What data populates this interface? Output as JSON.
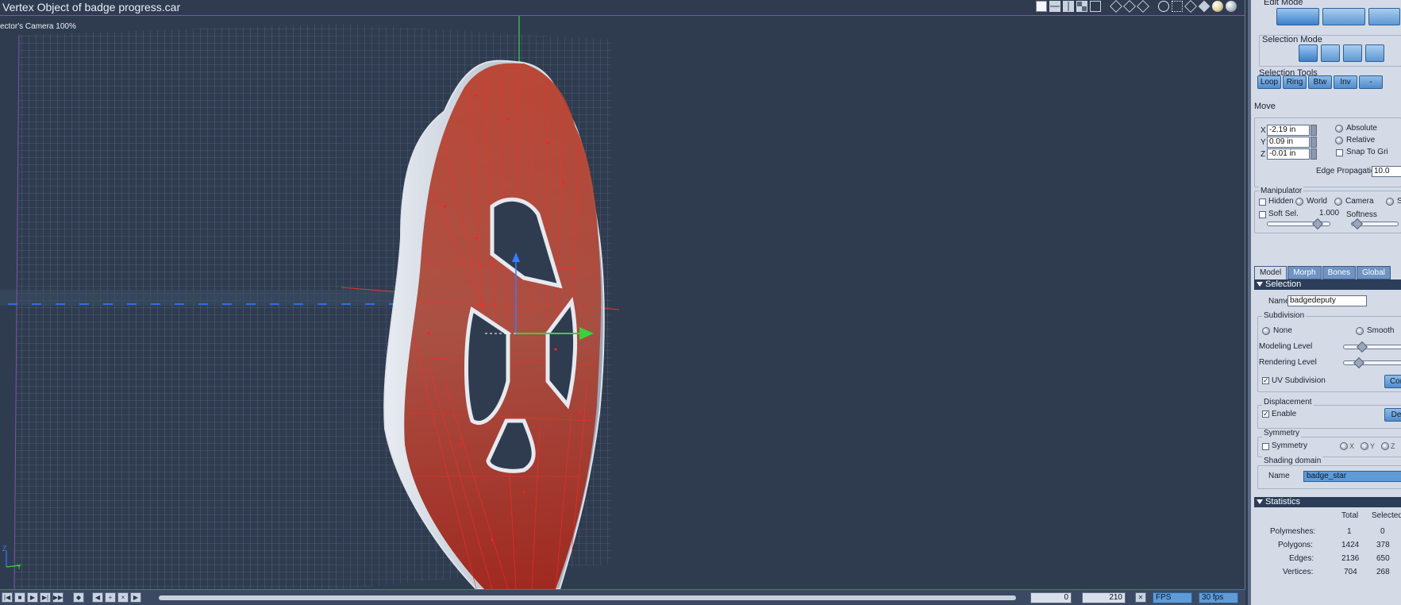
{
  "viewport": {
    "title": "Vertex Object of badge progress.car",
    "camera_label": "ector's Camera 100%",
    "axis_labels": {
      "z": "Z",
      "y": "Y"
    }
  },
  "timeline": {
    "current_frame": "0",
    "end_frame": "210",
    "mode": "FPS",
    "fps": "30 fps"
  },
  "panel": {
    "edit_mode_label": "Edit Mode",
    "selection_mode_label": "Selection Mode",
    "selection_tools_label": "Selection Tools",
    "selection_tools": [
      "Loop",
      "Ring",
      "Btw",
      "Inv",
      "-"
    ],
    "move_label": "Move",
    "move": {
      "x_label": "X",
      "x_value": "-2.19 in",
      "y_label": "Y",
      "y_value": "0.09 in",
      "z_label": "Z",
      "z_value": "-0.01 in",
      "absolute": "Absolute",
      "relative": "Relative",
      "snap": "Snap To Gri",
      "edge_prop_label": "Edge Propagation",
      "edge_prop_value": "10.0"
    },
    "manipulator": {
      "label": "Manipulator",
      "hidden": "Hidden",
      "world": "World",
      "camera": "Camera",
      "screen": "S",
      "soft_sel": "Soft Sel.",
      "soft_sel_value": "1.000",
      "softness": "Softness"
    },
    "tabs": [
      "Model",
      "Morph",
      "Bones",
      "Global"
    ],
    "selection_header": "Selection",
    "name_label": "Name",
    "name_value": "badgedeputy",
    "subdivision": {
      "label": "Subdivision",
      "none": "None",
      "smooth": "Smooth",
      "modeling_level": "Modeling Level",
      "rendering_level": "Rendering Level",
      "uv_subdivision": "UV Subdivision",
      "config_button": "Cor"
    },
    "displacement": {
      "label": "Displacement",
      "enable": "Enable",
      "button": "De"
    },
    "symmetry": {
      "label": "Symmetry",
      "checkbox": "Symmetry",
      "x": "X",
      "y": "Y",
      "z": "Z"
    },
    "shading_domain": {
      "label": "Shading domain",
      "name_label": "Name",
      "value": "badge_star"
    },
    "statistics": {
      "header": "Statistics",
      "col_total": "Total",
      "col_selected": "Selected",
      "rows": [
        {
          "label": "Polymeshes:",
          "total": "1",
          "selected": "0"
        },
        {
          "label": "Polygons:",
          "total": "1424",
          "selected": "378"
        },
        {
          "label": "Edges:",
          "total": "2136",
          "selected": "650"
        },
        {
          "label": "Vertices:",
          "total": "704",
          "selected": "268"
        }
      ]
    }
  }
}
